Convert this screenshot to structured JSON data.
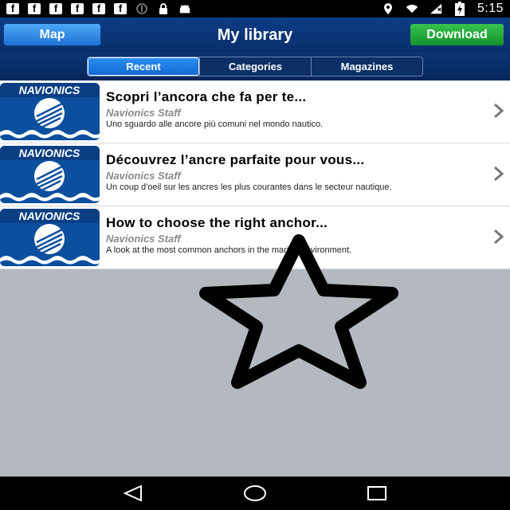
{
  "status_bar": {
    "notification_icons": [
      "facebook-icon",
      "facebook-icon",
      "facebook-icon",
      "facebook-icon",
      "facebook-icon",
      "facebook-icon",
      "circle-icon",
      "lock-icon",
      "android-icon"
    ],
    "fb_glyph": "f",
    "right_icons": [
      "location-icon",
      "wifi-icon",
      "signal-icon",
      "battery-icon"
    ],
    "time": "5:15"
  },
  "header": {
    "map_label": "Map",
    "title": "My library",
    "download_label": "Download"
  },
  "tabs": [
    {
      "label": "Recent",
      "active": true
    },
    {
      "label": "Categories",
      "active": false
    },
    {
      "label": "Magazines",
      "active": false
    }
  ],
  "list": [
    {
      "logo_text": "NAVIONICS",
      "title": "Scopri l’ancora che fa per te...",
      "author": "Navionics Staff",
      "description": "Uno sguardo alle ancore più comuni nel mondo nautico."
    },
    {
      "logo_text": "NAVIONICS",
      "title": "Découvrez l’ancre parfaite pour vous...",
      "author": "Navionics Staff",
      "description": "Un coup d'oeil sur les ancres les plus courantes dans le secteur nautique."
    },
    {
      "logo_text": "NAVIONICS",
      "title": "How to choose the right anchor...",
      "author": "Navionics Staff",
      "description": "A look at the most common anchors in the marine environment."
    }
  ],
  "colors": {
    "header_bg": "#0d3c85",
    "map_button": "#1f72d6",
    "download_button": "#15922b",
    "content_bg": "#b4b9c0"
  },
  "nav_icons": [
    "back-icon",
    "home-icon",
    "recents-icon"
  ]
}
